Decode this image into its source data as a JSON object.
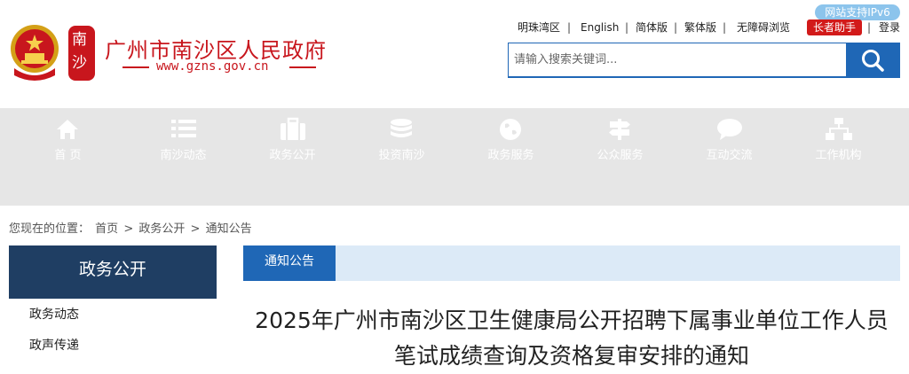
{
  "header": {
    "site_title": "广州市南沙区人民政府",
    "site_url": "www.gzns.gov.cn",
    "seal_chars": [
      "南",
      "沙"
    ],
    "ipv6_badge": "网站支持IPv6"
  },
  "topnav": {
    "items": [
      "明珠湾区",
      "English",
      "简体版",
      "繁体版",
      "无障碍浏览",
      "长者助手",
      "登录"
    ],
    "separator": "|"
  },
  "search": {
    "placeholder": "请输入搜索关键词...",
    "button_icon": "search-icon"
  },
  "mainnav": {
    "items": [
      {
        "label": "首  页",
        "icon": "home-icon"
      },
      {
        "label": "南沙动态",
        "icon": "list-icon"
      },
      {
        "label": "政务公开",
        "icon": "briefcase-icon"
      },
      {
        "label": "投资南沙",
        "icon": "coins-icon"
      },
      {
        "label": "政务服务",
        "icon": "globe-icon"
      },
      {
        "label": "公众服务",
        "icon": "signpost-icon"
      },
      {
        "label": "互动交流",
        "icon": "chat-icon"
      },
      {
        "label": "工作机构",
        "icon": "org-chart-icon"
      }
    ]
  },
  "breadcrumb": {
    "prefix": "您现在的位置：",
    "items": [
      "首页",
      "政务公开",
      "通知公告"
    ],
    "separator": ">"
  },
  "sidebar": {
    "title": "政务公开",
    "items": [
      "政务动态",
      "政声传递"
    ]
  },
  "content": {
    "tab_label": "通知公告",
    "article_title_line1": "2025年广州市南沙区卫生健康局公开招聘下属事业单位工作人员",
    "article_title_line2": "笔试成绩查询及资格复审安排的通知"
  },
  "colors": {
    "brand_red": "#c8161d",
    "primary_blue": "#1f67b6",
    "sidebar_navy": "#1f3e63",
    "nav_gray": "#e6e6e6",
    "tabbar_light_blue": "#dceaf7",
    "badge_blue": "#8cc4ec"
  }
}
